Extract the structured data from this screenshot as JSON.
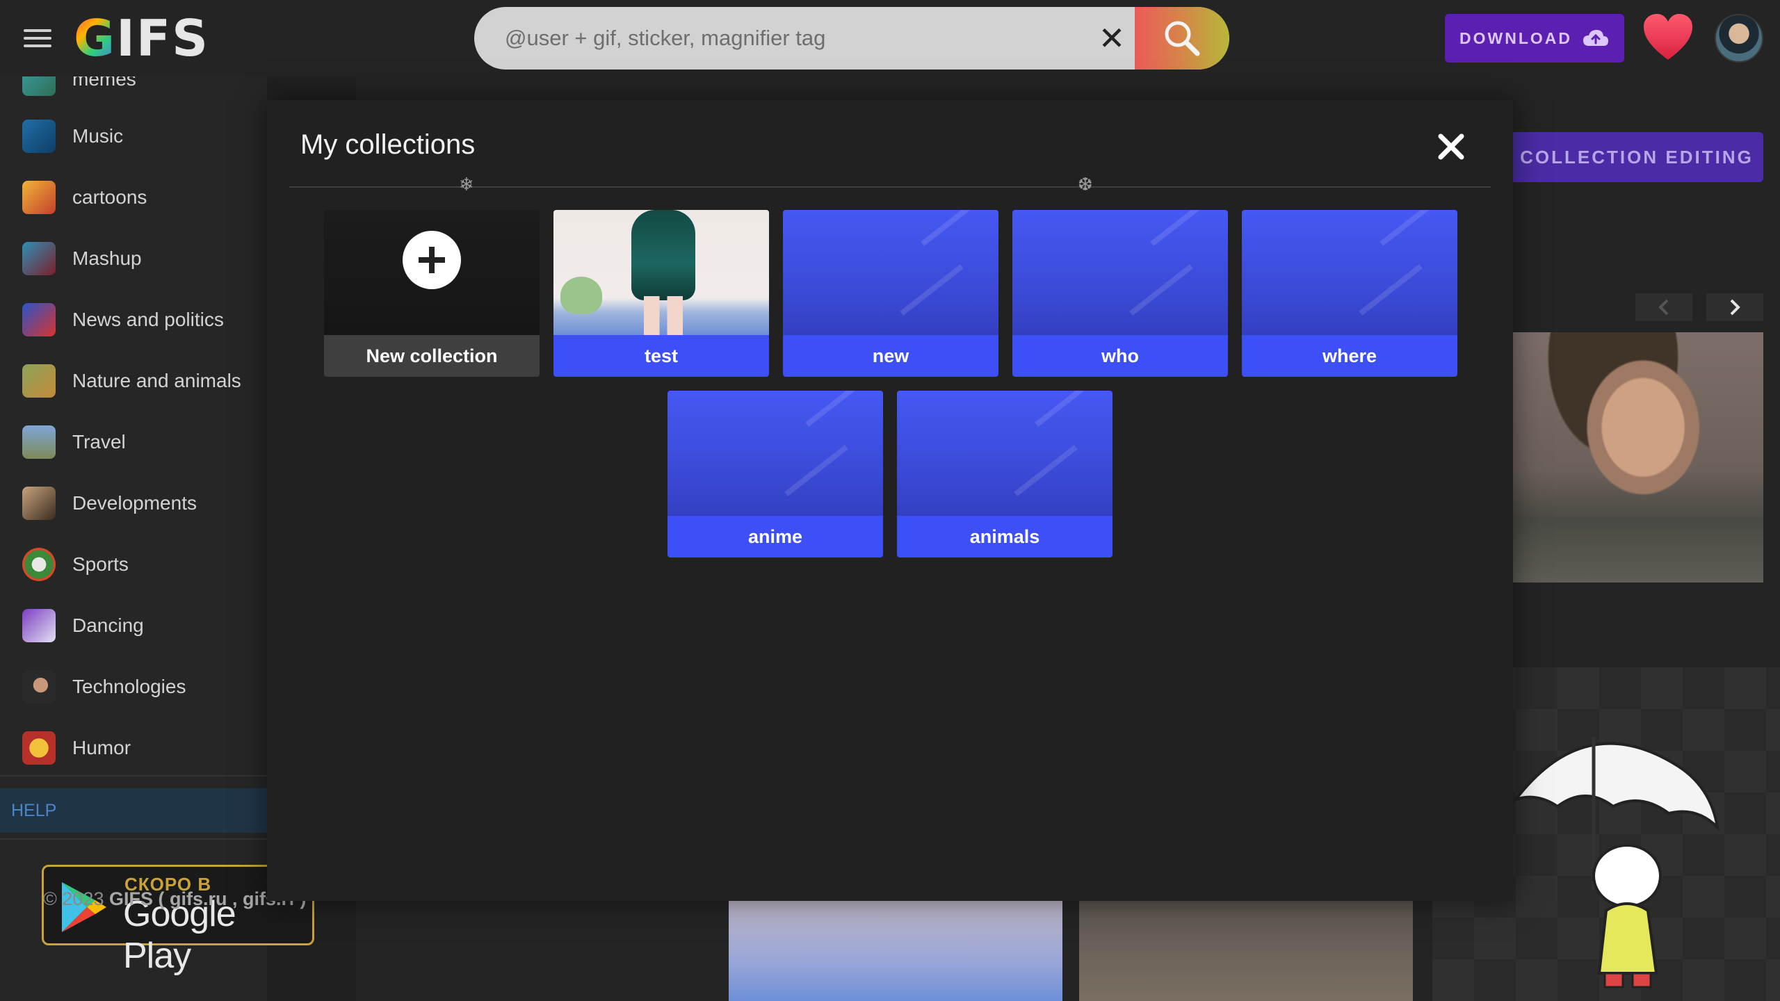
{
  "header": {
    "logo_g": "G",
    "logo_rest": "IFS",
    "search": {
      "placeholder": "@user + gif, sticker, magnifier tag"
    },
    "download_label": "DOWNLOAD"
  },
  "sidebar": {
    "items": [
      {
        "label": "memes"
      },
      {
        "label": "Music"
      },
      {
        "label": "cartoons"
      },
      {
        "label": "Mashup"
      },
      {
        "label": "News and politics"
      },
      {
        "label": "Nature and animals"
      },
      {
        "label": "Travel"
      },
      {
        "label": "Developments"
      },
      {
        "label": "Sports"
      },
      {
        "label": "Dancing"
      },
      {
        "label": "Technologies"
      },
      {
        "label": "Humor"
      }
    ],
    "help_label": "HELP",
    "google_play": {
      "soon": "СКОРО В",
      "store": "Google Play"
    },
    "copyright": {
      "prefix": "© 2023",
      "brand": "GIFS ( gifs.ru , gifs.rf )"
    }
  },
  "background": {
    "collection_editing_label": "COLLECTION EDITING"
  },
  "modal": {
    "title": "My collections",
    "new_collection_label": "New collection",
    "collections": [
      {
        "name": "test"
      },
      {
        "name": "new"
      },
      {
        "name": "who"
      },
      {
        "name": "where"
      },
      {
        "name": "anime"
      },
      {
        "name": "animals"
      }
    ]
  },
  "colors": {
    "accent_purple": "#5b1fb1",
    "collection_blue": "#3d4ff7",
    "help_blue": "#4a85c8",
    "gold": "#c9a23a"
  },
  "icons": [
    "menu-icon",
    "clear-icon",
    "search-icon",
    "cloud-upload-icon",
    "heart-icon",
    "close-icon",
    "plus-icon",
    "chevron-left-icon",
    "chevron-right-icon",
    "snowflake-icon",
    "google-play-icon"
  ]
}
